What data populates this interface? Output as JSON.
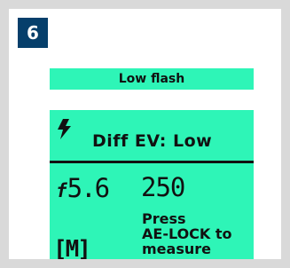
{
  "step": {
    "number": "6"
  },
  "top_bar": {
    "label": "Low flash"
  },
  "lcd": {
    "status": {
      "icon": "flash-bolt-icon",
      "text": "Diff EV: Low"
    },
    "aperture": {
      "prefix": "f",
      "value": "5.6"
    },
    "shutter": "250",
    "mode": "[M]",
    "message": {
      "line1": "Press",
      "line2": "AE-LOCK to",
      "line3": "measure"
    }
  },
  "colors": {
    "lcd_background": "#2ef5b7",
    "badge_background": "#063f6b",
    "frame": "#d9d9d9"
  }
}
